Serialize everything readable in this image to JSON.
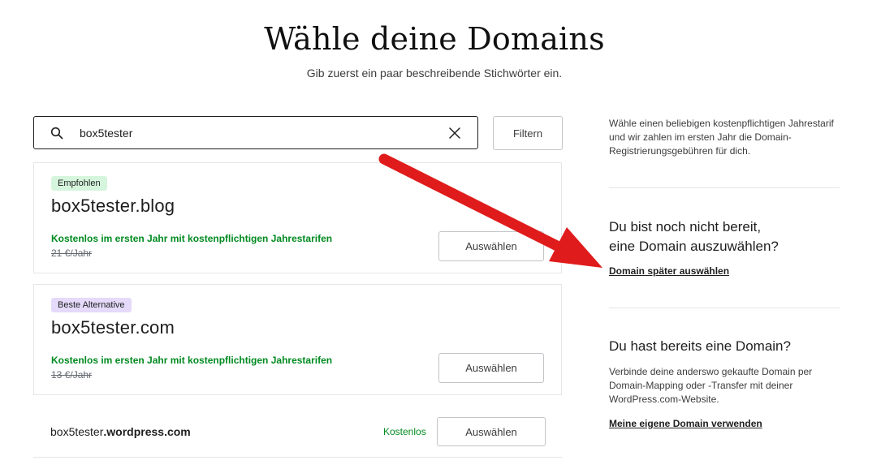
{
  "header": {
    "title": "Wähle deine Domains",
    "subtitle": "Gib zuerst ein paar beschreibende Stichwörter ein."
  },
  "search": {
    "value": "box5tester",
    "icon": "search-icon",
    "clear_icon": "close-icon"
  },
  "filter": {
    "label": "Filtern"
  },
  "results": [
    {
      "badge": "Empfohlen",
      "badge_color": "#d6f5dd",
      "domain": "box5tester.blog",
      "promo": "Kostenlos im ersten Jahr mit kostenpflichtigen Jahrestarifen",
      "old_price": "21 €/Jahr",
      "button": "Auswählen"
    },
    {
      "badge": "Beste Alternative",
      "badge_color": "#e5dafa",
      "domain": "box5tester.com",
      "promo": "Kostenlos im ersten Jahr mit kostenpflichtigen Jahrestarifen",
      "old_price": "13 €/Jahr",
      "button": "Auswählen"
    }
  ],
  "free_domain": {
    "name_prefix": "box5tester",
    "name_suffix": ".wordpress.com",
    "price": "Kostenlos",
    "button": "Auswählen"
  },
  "sidebar": {
    "intro": "Wähle einen beliebigen kostenpflichtigen Jahrestarif und wir zahlen im ersten Jahr die Domain-Registrierungsgebühren für dich.",
    "later": {
      "heading_line1": "Du bist noch nicht bereit,",
      "heading_line2": "eine Domain auszuwählen?",
      "link": "Domain später auswählen"
    },
    "own": {
      "heading": "Du hast bereits eine Domain?",
      "text": "Verbinde deine anderswo gekaufte Domain per Domain-Mapping oder -Transfer mit deiner WordPress.com-Website.",
      "link": "Meine eigene Domain verwenden"
    }
  },
  "colors": {
    "promo_green": "#008a20",
    "annotation_arrow": "#e01b1b"
  }
}
